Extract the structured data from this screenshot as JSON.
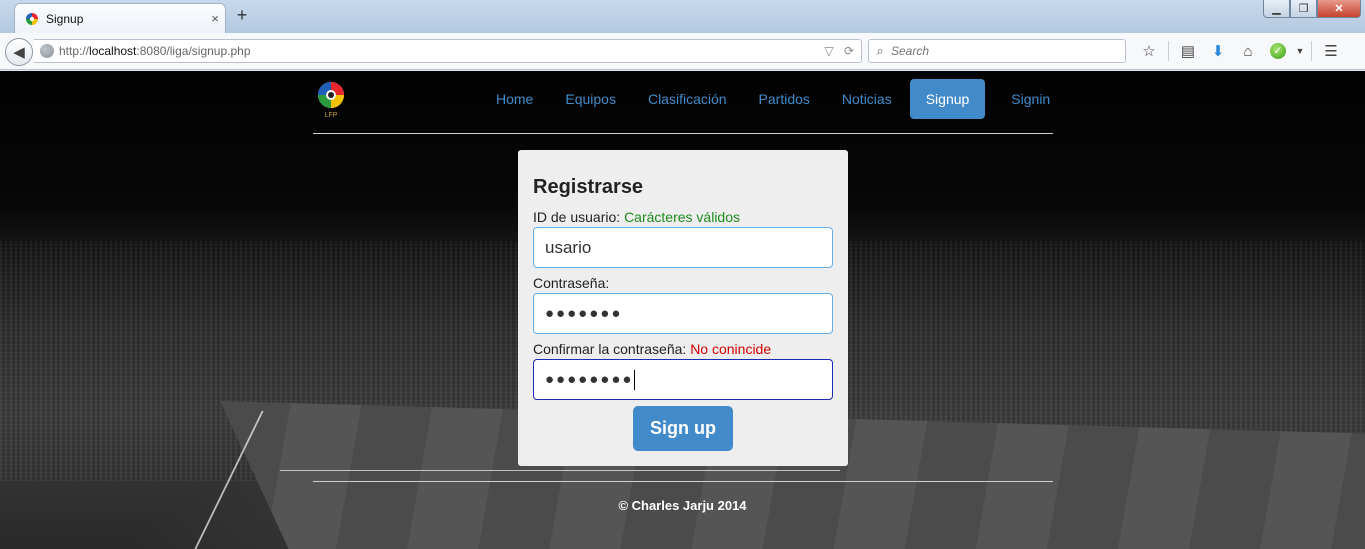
{
  "browser": {
    "tab_title": "Signup",
    "tab_close": "×",
    "new_tab": "+",
    "window_buttons": {
      "minimize": "▁",
      "restore": "❐",
      "close": "✕"
    },
    "url": {
      "prefix": "http://",
      "host": "localhost",
      "rest": ":8080/liga/signup.php"
    },
    "search_placeholder": "Search",
    "icons": [
      "bookmark-star-icon",
      "reading-list-icon",
      "download-icon",
      "home-icon",
      "addon-check-icon",
      "dropdown-icon",
      "menu-icon"
    ]
  },
  "site": {
    "logo_text": "LFP",
    "nav": [
      {
        "label": "Home",
        "active": false
      },
      {
        "label": "Equipos",
        "active": false
      },
      {
        "label": "Clasificación",
        "active": false
      },
      {
        "label": "Partidos",
        "active": false
      },
      {
        "label": "Noticias",
        "active": false
      },
      {
        "label": "Signup",
        "active": true
      },
      {
        "label": "Signin",
        "active": false
      }
    ],
    "accent_color": "#428bca"
  },
  "form": {
    "title": "Registrarse",
    "user_label": "ID de usuario:",
    "user_status": "Carácteres válidos",
    "user_value": "usario",
    "password_label": "Contraseña:",
    "password_value": "●●●●●●●",
    "confirm_label": "Confirmar la contraseña:",
    "confirm_status": "No conincide",
    "confirm_value": "●●●●●●●●",
    "submit_label": "Sign up",
    "status_colors": {
      "ok": "#1e8c1e",
      "error": "#d40000"
    }
  },
  "footer": {
    "text": "© Charles Jarju 2014"
  }
}
